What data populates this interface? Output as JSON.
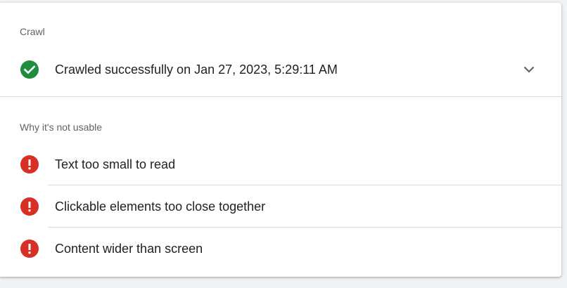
{
  "crawl": {
    "section_title": "Crawl",
    "status_icon": "check-circle-icon",
    "status_color": "#1e8e3e",
    "status_text": "Crawled successfully on Jan 27, 2023, 5:29:11 AM",
    "expand_icon": "chevron-down-icon"
  },
  "usability": {
    "section_title": "Why it's not usable",
    "issue_icon": "error-circle-icon",
    "issue_color": "#d93025",
    "issues": [
      {
        "label": "Text too small to read"
      },
      {
        "label": "Clickable elements too close together"
      },
      {
        "label": "Content wider than screen"
      }
    ]
  }
}
